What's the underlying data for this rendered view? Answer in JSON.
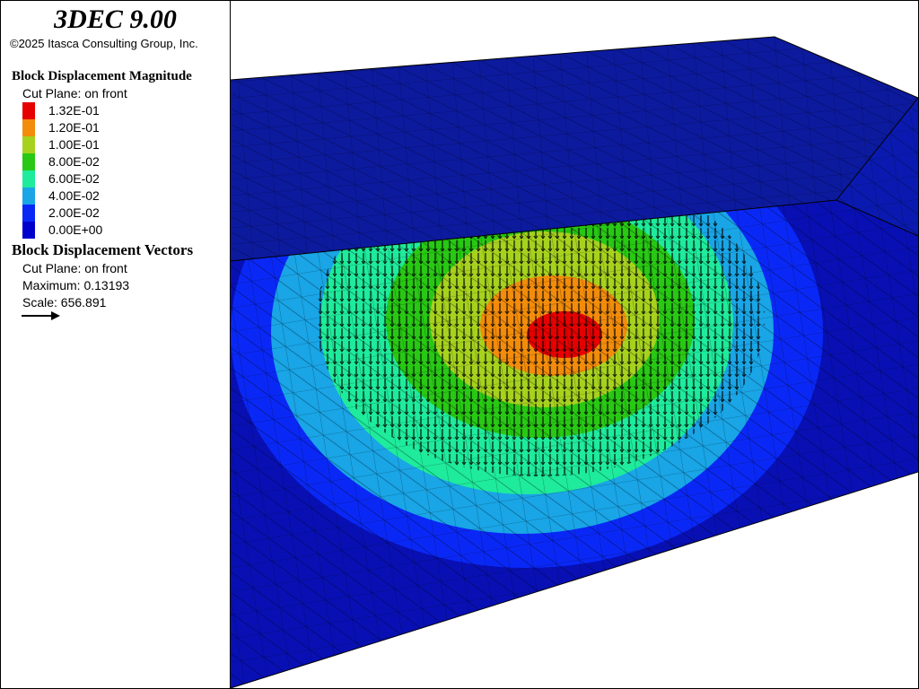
{
  "app": {
    "title": "3DEC 9.00",
    "copyright": "©2025 Itasca Consulting Group, Inc."
  },
  "legend": {
    "contour": {
      "title": "Block  Displacement Magnitude",
      "cut_plane": "Cut Plane: on front",
      "entries": [
        {
          "label": "1.32E-01",
          "color": "#e60000"
        },
        {
          "label": "1.20E-01",
          "color": "#f28c0a"
        },
        {
          "label": "1.00E-01",
          "color": "#a6d21e"
        },
        {
          "label": "8.00E-02",
          "color": "#28c814"
        },
        {
          "label": "6.00E-02",
          "color": "#1eeb9b"
        },
        {
          "label": "4.00E-02",
          "color": "#19a5e6"
        },
        {
          "label": "2.00E-02",
          "color": "#0a28f5"
        },
        {
          "label": "0.00E+00",
          "color": "#0000cd"
        }
      ]
    },
    "vectors": {
      "title": "Block Displacement Vectors",
      "cut_plane": "Cut Plane: on front",
      "maximum": "Maximum: 0.13193",
      "scale": "Scale: 656.891",
      "arrow_icon": "arrow-icon"
    }
  },
  "plot": {
    "background": "#ffffff",
    "colors": {
      "top_face": "#0c1a9e",
      "front_face": "#0810b4",
      "side_face": "#0a1ab0",
      "mesh": "#000000"
    }
  }
}
